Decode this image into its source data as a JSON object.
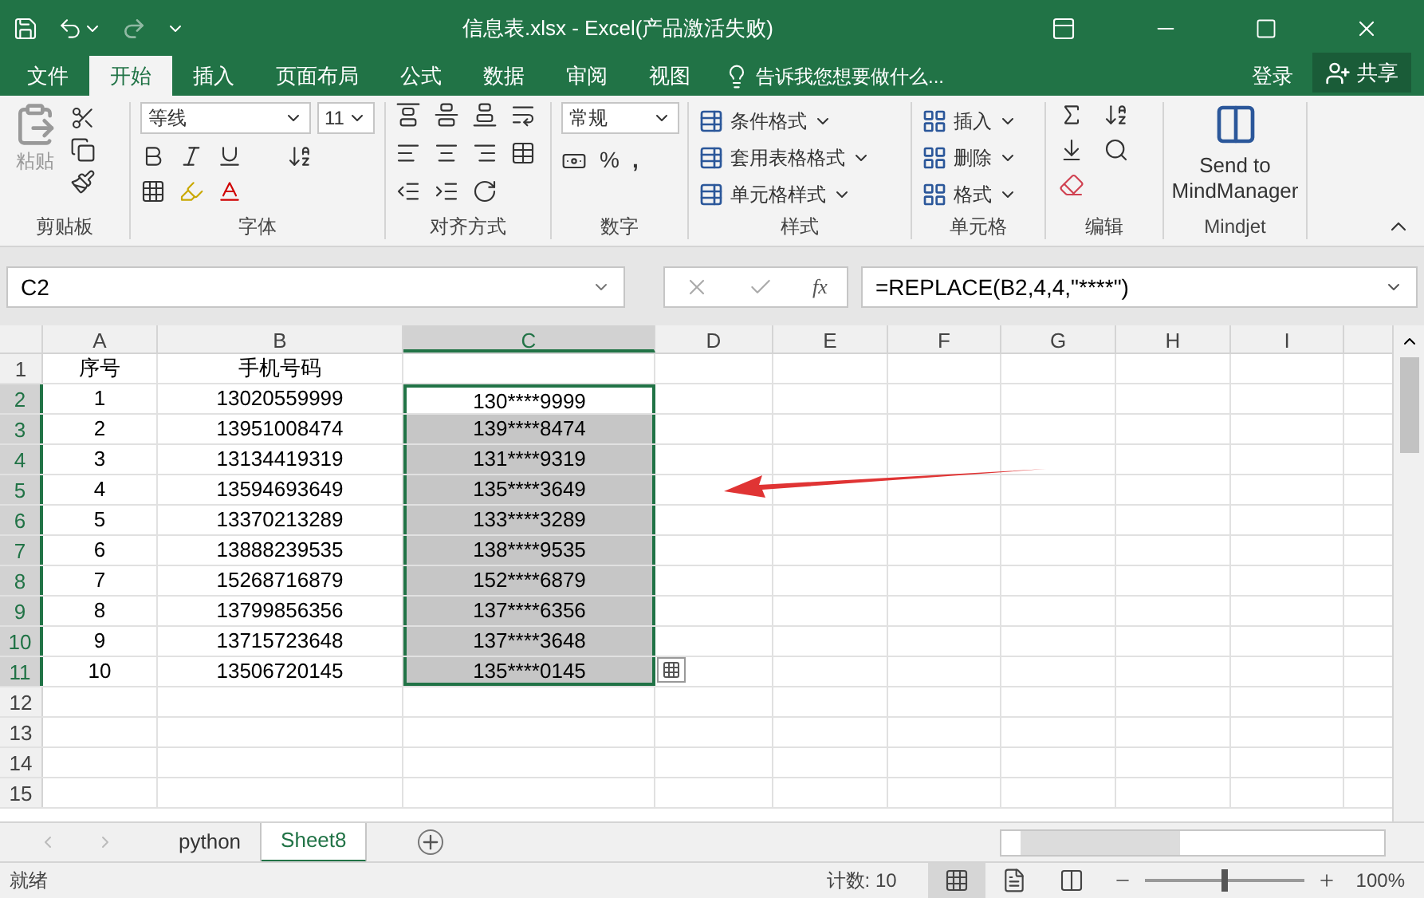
{
  "window": {
    "title": "信息表.xlsx - Excel(产品激活失败)"
  },
  "ribbon_tabs": [
    {
      "label": "文件",
      "selected": false
    },
    {
      "label": "开始",
      "selected": true
    },
    {
      "label": "插入",
      "selected": false
    },
    {
      "label": "页面布局",
      "selected": false
    },
    {
      "label": "公式",
      "selected": false
    },
    {
      "label": "数据",
      "selected": false
    },
    {
      "label": "审阅",
      "selected": false
    },
    {
      "label": "视图",
      "selected": false
    }
  ],
  "tell_me": "告诉我您想要做什么...",
  "sign_in": "登录",
  "share": "共享",
  "ribbon": {
    "clipboard": {
      "paste": "粘贴",
      "label": "剪贴板"
    },
    "font": {
      "name": "等线",
      "size": "11",
      "label": "字体"
    },
    "alignment": {
      "label": "对齐方式"
    },
    "number": {
      "format": "常规",
      "percent": "%",
      "comma": ",",
      "label": "数字"
    },
    "styles": {
      "buttons": [
        "条件格式",
        "套用表格格式",
        "单元格样式"
      ],
      "label": "样式"
    },
    "cells": {
      "buttons": [
        "插入",
        "删除",
        "格式"
      ],
      "label": "单元格"
    },
    "editing": {
      "label": "编辑"
    },
    "mindjet": {
      "button": "Send to MindManager",
      "label": "Mindjet"
    }
  },
  "formula_bar": {
    "name_box": "C2",
    "function_label": "fx",
    "formula": "=REPLACE(B2,4,4,\"****\")"
  },
  "sheet": {
    "columns": [
      {
        "label": "A",
        "selected": false
      },
      {
        "label": "B",
        "selected": false
      },
      {
        "label": "C",
        "selected": true
      },
      {
        "label": "D",
        "selected": false
      },
      {
        "label": "E",
        "selected": false
      },
      {
        "label": "F",
        "selected": false
      },
      {
        "label": "G",
        "selected": false
      },
      {
        "label": "H",
        "selected": false
      },
      {
        "label": "I",
        "selected": false
      }
    ],
    "rows": [
      {
        "header": "1",
        "selected": false,
        "active": false,
        "cells": [
          "序号",
          "手机号码",
          ""
        ]
      },
      {
        "header": "2",
        "selected": true,
        "active": true,
        "cells": [
          "1",
          "13020559999",
          "130****9999"
        ]
      },
      {
        "header": "3",
        "selected": true,
        "active": false,
        "cells": [
          "2",
          "13951008474",
          "139****8474"
        ]
      },
      {
        "header": "4",
        "selected": true,
        "active": false,
        "cells": [
          "3",
          "13134419319",
          "131****9319"
        ]
      },
      {
        "header": "5",
        "selected": true,
        "active": false,
        "cells": [
          "4",
          "13594693649",
          "135****3649"
        ]
      },
      {
        "header": "6",
        "selected": true,
        "active": false,
        "cells": [
          "5",
          "13370213289",
          "133****3289"
        ]
      },
      {
        "header": "7",
        "selected": true,
        "active": false,
        "cells": [
          "6",
          "13888239535",
          "138****9535"
        ]
      },
      {
        "header": "8",
        "selected": true,
        "active": false,
        "cells": [
          "7",
          "15268716879",
          "152****6879"
        ]
      },
      {
        "header": "9",
        "selected": true,
        "active": false,
        "cells": [
          "8",
          "13799856356",
          "137****6356"
        ]
      },
      {
        "header": "10",
        "selected": true,
        "active": false,
        "cells": [
          "9",
          "13715723648",
          "137****3648"
        ]
      },
      {
        "header": "11",
        "selected": true,
        "active": false,
        "cells": [
          "10",
          "13506720145",
          "135****0145"
        ]
      },
      {
        "header": "12",
        "selected": false,
        "active": false,
        "cells": [
          "",
          "",
          ""
        ]
      },
      {
        "header": "13",
        "selected": false,
        "active": false,
        "cells": [
          "",
          "",
          ""
        ]
      },
      {
        "header": "14",
        "selected": false,
        "active": false,
        "cells": [
          "",
          "",
          ""
        ]
      },
      {
        "header": "15",
        "selected": false,
        "active": false,
        "cells": [
          "",
          "",
          ""
        ]
      }
    ]
  },
  "sheet_tabs": [
    {
      "label": "python",
      "selected": false
    },
    {
      "label": "Sheet8",
      "selected": true
    }
  ],
  "status_bar": {
    "status": "就绪",
    "count": "计数: 10",
    "zoom": "100%",
    "level": 0.5
  }
}
